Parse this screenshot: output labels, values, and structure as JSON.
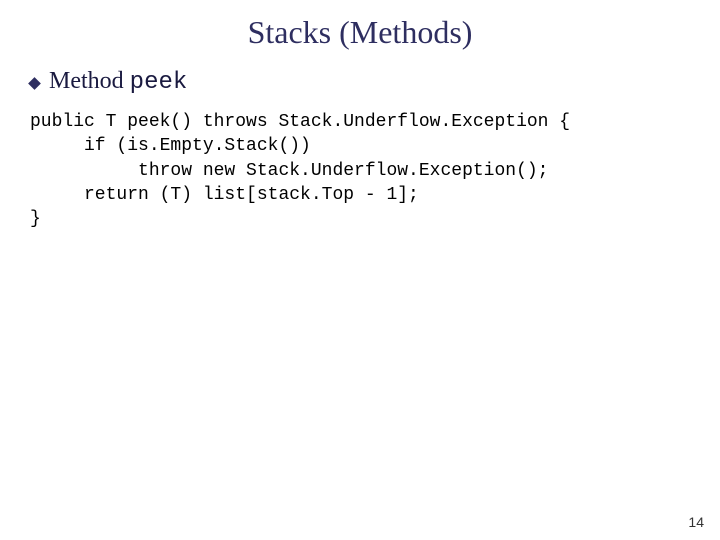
{
  "slide": {
    "title": "Stacks (Methods)",
    "bullet": {
      "label_serif": "Method ",
      "label_mono": "peek"
    },
    "code": {
      "line1": "public T peek() throws Stack.Underflow.Exception {",
      "line2": "     if (is.Empty.Stack())",
      "line3": "          throw new Stack.Underflow.Exception();",
      "line4": "     return (T) list[stack.Top - 1];",
      "line5": "}"
    },
    "page_number": "14"
  }
}
